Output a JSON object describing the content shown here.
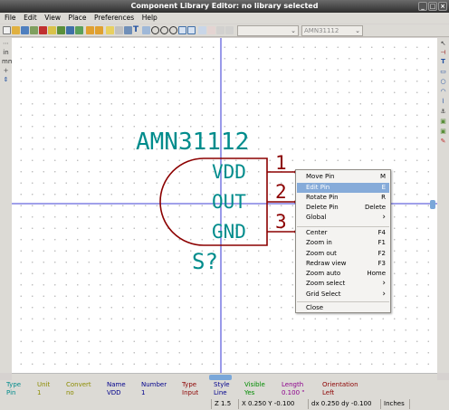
{
  "window": {
    "title": "Component Library Editor: no library selected"
  },
  "menu": [
    "File",
    "Edit",
    "View",
    "Place",
    "Preferences",
    "Help"
  ],
  "toolbar": {
    "unit_select": "",
    "component_select": "AMN31112"
  },
  "component": {
    "name": "AMN31112",
    "reference": "S?",
    "pins": [
      {
        "name": "VDD",
        "number": "1"
      },
      {
        "name": "OUT",
        "number": "2"
      },
      {
        "name": "GND",
        "number": "3"
      }
    ]
  },
  "context_menu": {
    "items": [
      {
        "label": "Move Pin",
        "accel": "M"
      },
      {
        "label": "Edit Pin",
        "accel": "E",
        "highlighted": true
      },
      {
        "label": "Rotate Pin",
        "accel": "R"
      },
      {
        "label": "Delete Pin",
        "accel": "Delete"
      },
      {
        "label": "Global",
        "accel": "›",
        "submenu": true
      },
      {
        "label": "Center",
        "accel": "F4"
      },
      {
        "label": "Zoom in",
        "accel": "F1"
      },
      {
        "label": "Zoom out",
        "accel": "F2"
      },
      {
        "label": "Redraw view",
        "accel": "F3"
      },
      {
        "label": "Zoom auto",
        "accel": "Home"
      },
      {
        "label": "Zoom select",
        "accel": "›",
        "submenu": true
      },
      {
        "label": "Grid Select",
        "accel": "›",
        "submenu": true
      },
      {
        "label": "Close",
        "accel": ""
      }
    ]
  },
  "info_panel": [
    {
      "header": "Type",
      "value": "Pin",
      "color": "#008c8c"
    },
    {
      "header": "Unit",
      "value": "1",
      "color": "#8c8c00"
    },
    {
      "header": "Convert",
      "value": "no",
      "color": "#8c8c00"
    },
    {
      "header": "Name",
      "value": "VDD",
      "color": "#00008c"
    },
    {
      "header": "Number",
      "value": "1",
      "color": "#00008c"
    },
    {
      "header": "Type",
      "value": "Input",
      "color": "#8c0000"
    },
    {
      "header": "Style",
      "value": "Line",
      "color": "#00008c"
    },
    {
      "header": "Visible",
      "value": "Yes",
      "color": "#008c00"
    },
    {
      "header": "Length",
      "value": "0.100 \"",
      "color": "#8c008c"
    },
    {
      "header": "Orientation",
      "value": "Left",
      "color": "#8c0000"
    }
  ],
  "status_bar": {
    "zoom": "Z 1.5",
    "cursor": "X 0.250  Y -0.100",
    "delta": "dx 0.250  dy -0.100",
    "units": "Inches"
  },
  "colors": {
    "body_outline": "#8c0000",
    "pin_text": "#008c8c",
    "pin_number": "#8c0000",
    "crosshair": "#0000c8",
    "menu_highlight": "#86abd9"
  }
}
